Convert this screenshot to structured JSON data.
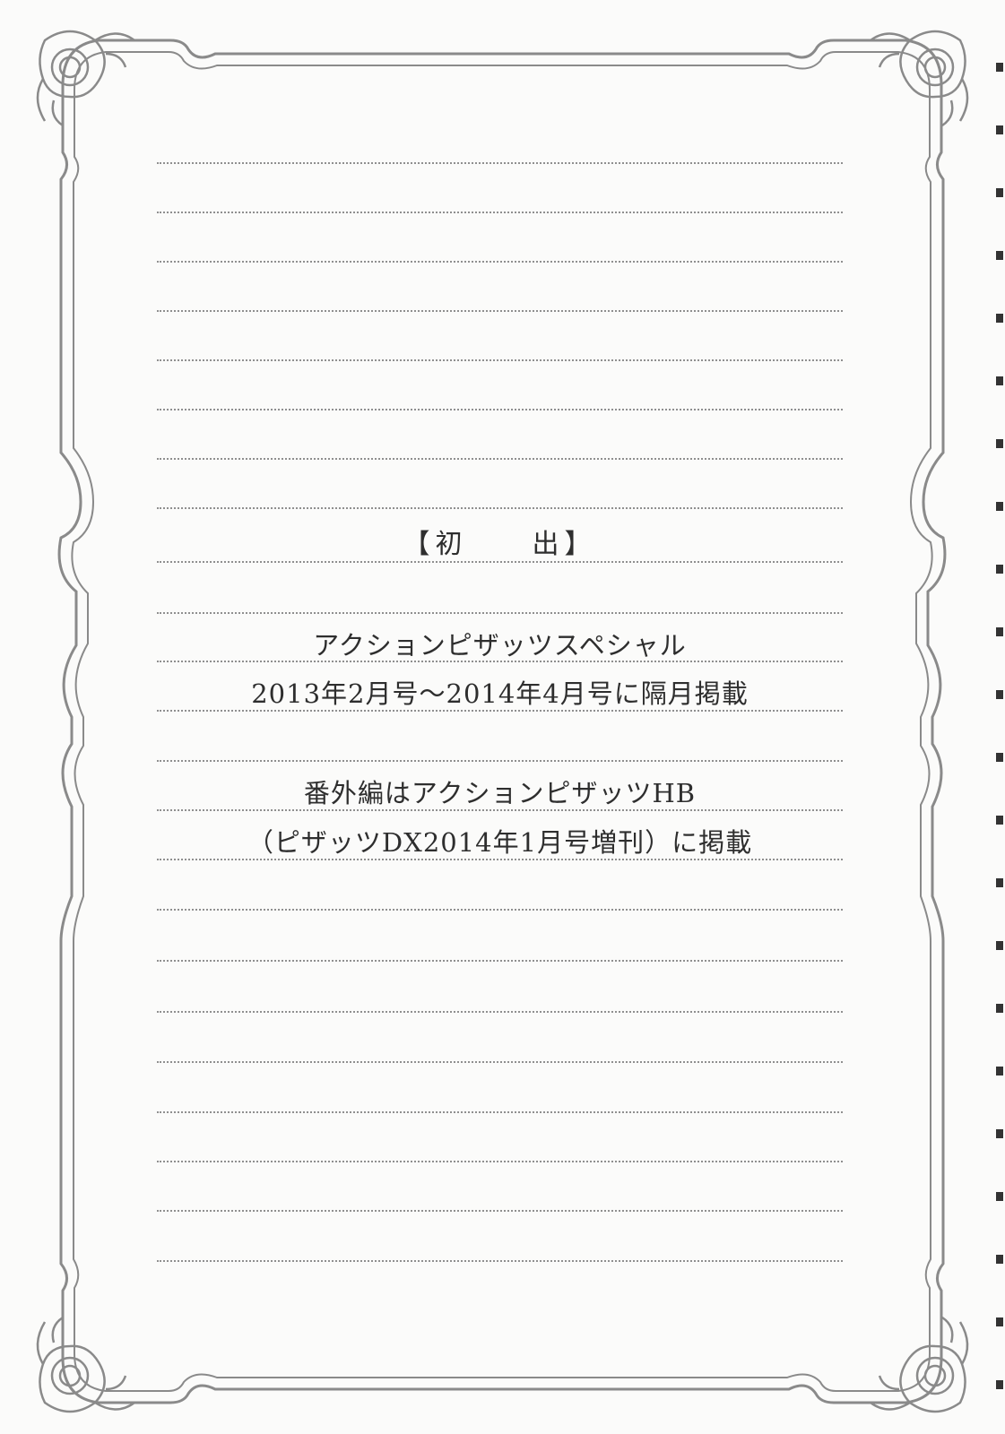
{
  "document": {
    "heading": "【初　　出】",
    "lines": [
      "アクションピザッツスペシャル",
      "2013年2月号～2014年4月号に隔月掲載",
      "番外編はアクションピザッツHB",
      "（ピザッツDX2014年1月号増刊）に掲載"
    ]
  },
  "colors": {
    "frame": "#8a8a8a",
    "text": "#2e2e2e",
    "rule": "#8f8f8f",
    "paper": "#fbfbfa"
  },
  "icons": [
    "corner-ornament-icon"
  ]
}
